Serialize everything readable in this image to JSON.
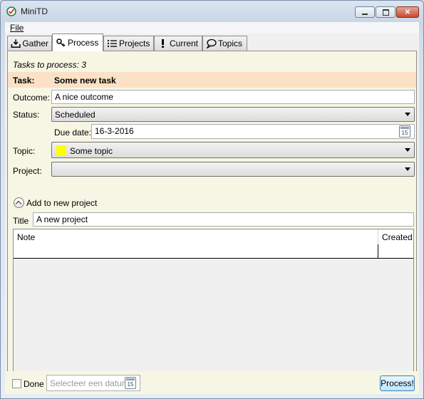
{
  "window": {
    "title": "MiniTD"
  },
  "menu": {
    "file": "File"
  },
  "tabs": [
    {
      "label": "Gather",
      "icon": "download-icon"
    },
    {
      "label": "Process",
      "icon": "key-icon"
    },
    {
      "label": "Projects",
      "icon": "list-icon"
    },
    {
      "label": "Current",
      "icon": "exclamation-icon"
    },
    {
      "label": "Topics",
      "icon": "speech-bubble-icon"
    }
  ],
  "process": {
    "tasks_to_process": "Tasks to process: 3",
    "task_label": "Task:",
    "task_value": "Some new task",
    "outcome_label": "Outcome:",
    "outcome_value": "A nice outcome",
    "status_label": "Status:",
    "status_value": "Scheduled",
    "due_date_label": "Due date:",
    "due_date_value": "16-3-2016",
    "calendar_day": "15",
    "topic_label": "Topic:",
    "topic_value": "Some topic",
    "topic_color": "#ffff00",
    "project_label": "Project:",
    "project_value": "",
    "add_project_label": "Add to new project",
    "title_label": "Title",
    "title_value": "A new project",
    "grid": {
      "col_note": "Note",
      "col_created": "Created"
    }
  },
  "bottom": {
    "done_label": "Done",
    "date_placeholder": "Selecteer een datum",
    "calendar_day": "15",
    "process_button": "Process!"
  }
}
